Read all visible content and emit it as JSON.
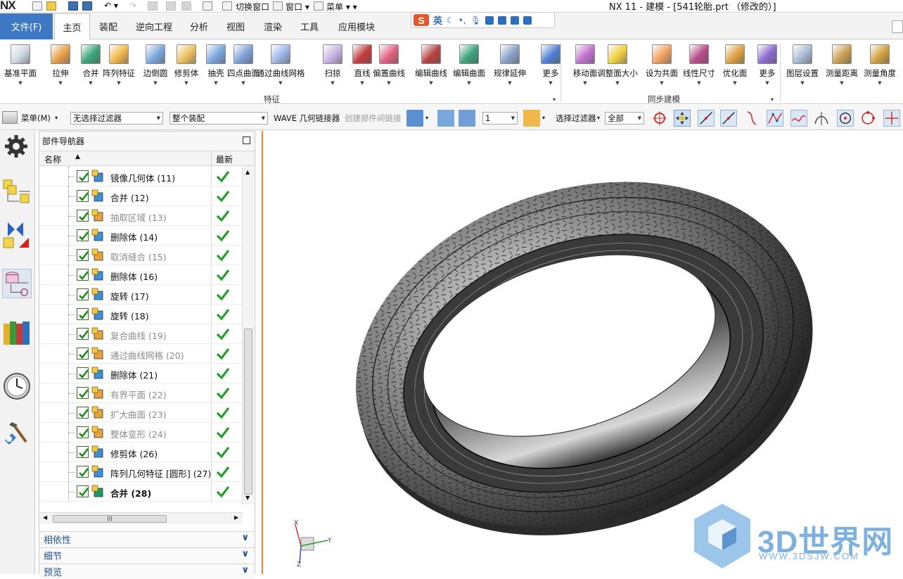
{
  "titlebar": {
    "logo": "NX",
    "switch_window": "切换窗口",
    "window_menu": "窗口",
    "menu_label": "菜单",
    "title": "NX 11 - 建模 - [541轮胎.prt （修改的）]"
  },
  "tabs": {
    "file": "文件(F)",
    "items": [
      "主页",
      "装配",
      "逆向工程",
      "分析",
      "视图",
      "渲染",
      "工具",
      "应用模块"
    ],
    "active": "主页"
  },
  "ime": {
    "label": "英"
  },
  "ribbon": {
    "buttons": [
      {
        "label": "基准平面",
        "icon": "datum-plane-icon"
      },
      {
        "label": "拉伸",
        "icon": "extrude-icon"
      },
      {
        "label": "合并",
        "icon": "unite-icon"
      },
      {
        "label": "阵列特征",
        "icon": "pattern-feature-icon"
      },
      {
        "label": "边倒圆",
        "icon": "edge-blend-icon"
      },
      {
        "label": "修剪体",
        "icon": "trim-body-icon"
      },
      {
        "label": "抽壳",
        "icon": "shell-icon"
      },
      {
        "label": "四点曲面",
        "icon": "four-point-surface-icon"
      },
      {
        "label": "通过曲线网格",
        "icon": "through-curve-mesh-icon"
      },
      {
        "label": "扫掠",
        "icon": "swept-icon"
      },
      {
        "label": "直线",
        "icon": "line-icon"
      },
      {
        "label": "偏置曲线",
        "icon": "offset-curve-icon"
      },
      {
        "label": "编辑曲线",
        "icon": "edit-curve-icon"
      },
      {
        "label": "编辑曲面",
        "icon": "edit-surface-icon"
      },
      {
        "label": "规律延伸",
        "icon": "law-extension-icon"
      },
      {
        "label": "更多",
        "icon": "more-icon"
      },
      {
        "label": "移动面",
        "icon": "move-face-icon"
      },
      {
        "label": "调整面大小",
        "icon": "resize-face-icon"
      },
      {
        "label": "设为共面",
        "icon": "make-coplanar-icon"
      },
      {
        "label": "线性尺寸",
        "icon": "linear-dimension-icon"
      },
      {
        "label": "优化面",
        "icon": "optimize-face-icon"
      },
      {
        "label": "更多",
        "icon": "more-sync-icon"
      },
      {
        "label": "图层设置",
        "icon": "layer-settings-icon"
      },
      {
        "label": "测量距离",
        "icon": "measure-distance-icon"
      },
      {
        "label": "测量角度",
        "icon": "measure-angle-icon"
      }
    ],
    "group_feature": "特征",
    "group_sync": "同步建模"
  },
  "toolbar2": {
    "menu": "菜单(M)",
    "filter": "无选择过滤器",
    "scope": "整个装配",
    "wave": "WAVE 几何链接器",
    "create_link": "创建部件间链接",
    "count": "1",
    "sel_filter": "选择过滤器",
    "all": "全部"
  },
  "navigator": {
    "title": "部件导航器",
    "col_name": "名称",
    "col_latest": "最新",
    "rows": [
      {
        "label": "镜像几何体 (11)",
        "state": "normal",
        "icon": "mirror-geometry-icon"
      },
      {
        "label": "合并 (12)",
        "state": "normal",
        "icon": "unite-icon"
      },
      {
        "label": "抽取区域 (13)",
        "state": "dim",
        "icon": "extract-region-icon"
      },
      {
        "label": "删除体 (14)",
        "state": "normal",
        "icon": "delete-body-icon"
      },
      {
        "label": "取消缝合 (15)",
        "state": "dim",
        "icon": "unsew-icon"
      },
      {
        "label": "删除体 (16)",
        "state": "normal",
        "icon": "delete-body-icon"
      },
      {
        "label": "旋转 (17)",
        "state": "normal",
        "icon": "revolve-icon"
      },
      {
        "label": "旋转 (18)",
        "state": "normal",
        "icon": "revolve-icon"
      },
      {
        "label": "复合曲线 (19)",
        "state": "dim",
        "icon": "composite-curve-icon"
      },
      {
        "label": "通过曲线网格 (20)",
        "state": "dim",
        "icon": "through-curve-mesh-icon"
      },
      {
        "label": "删除体 (21)",
        "state": "normal",
        "icon": "delete-body-icon"
      },
      {
        "label": "有界平面 (22)",
        "state": "dim",
        "icon": "bounded-plane-icon"
      },
      {
        "label": "扩大曲面 (23)",
        "state": "dim",
        "icon": "enlarge-surface-icon"
      },
      {
        "label": "整体变形 (24)",
        "state": "dim",
        "icon": "global-shaping-icon"
      },
      {
        "label": "修剪体 (26)",
        "state": "normal",
        "icon": "trim-body-icon"
      },
      {
        "label": "阵列几何特征 [圆形] (27)",
        "state": "normal",
        "icon": "pattern-geometry-icon"
      },
      {
        "label": "合并 (28)",
        "state": "bold",
        "icon": "unite-icon"
      }
    ],
    "accordions": [
      "相依性",
      "细节",
      "预览"
    ]
  },
  "viewport": {
    "watermark": "3D世界网",
    "watermark_url": "WWW.3DSJW.COM",
    "axis_x": "X",
    "axis_y": "Y",
    "axis_z": "Z"
  }
}
